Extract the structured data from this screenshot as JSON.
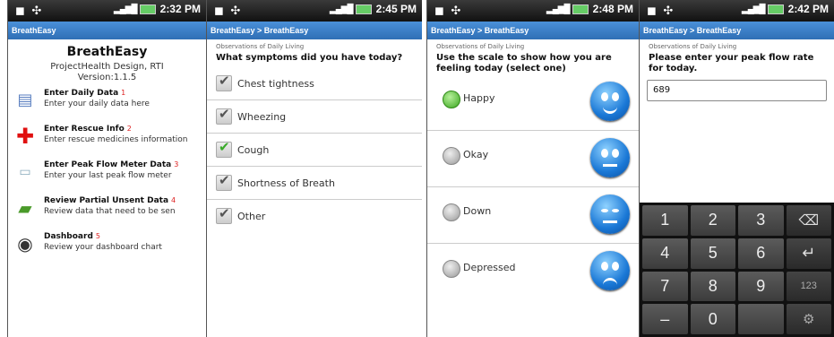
{
  "status": {
    "screen1_time": "2:32 PM",
    "screen2_time": "2:45 PM",
    "screen3_time": "2:48 PM",
    "screen4_time": "2:42 PM"
  },
  "screen1": {
    "title_bar": "BreathEasy",
    "app_title": "BreathEasy",
    "org_line1": "ProjectHealth Design, RTI",
    "org_line2": "Version:1.1.5",
    "menu": [
      {
        "title": "Enter Daily Data",
        "num": "1",
        "desc": "Enter your daily data here",
        "icon": "data-entry-icon"
      },
      {
        "title": "Enter Rescue Info",
        "num": "2",
        "desc": "Enter rescue medicines information",
        "icon": "red-cross-icon"
      },
      {
        "title": "Enter Peak Flow Meter Data",
        "num": "3",
        "desc": "Enter your last peak flow meter",
        "icon": "peak-flow-meter-icon"
      },
      {
        "title": "Review Partial Unsent Data",
        "num": "4",
        "desc": "Review data that need to be sen",
        "icon": "unsent-data-icon"
      },
      {
        "title": "Dashboard",
        "num": "5",
        "desc": "Review your dashboard chart",
        "icon": "dashboard-icon"
      }
    ]
  },
  "screen2": {
    "title_bar": "BreathEasy > BreathEasy",
    "subtitle": "Observations of Daily Living",
    "question": "What symptoms did you have today?",
    "symptoms": [
      "Chest tightness",
      "Wheezing",
      "Cough",
      "Shortness of Breath",
      "Other"
    ]
  },
  "screen3": {
    "title_bar": "BreathEasy > BreathEasy",
    "subtitle": "Observations of Daily Living",
    "question": "Use the scale to show how you are feeling today (select one)",
    "moods": [
      "Happy",
      "Okay",
      "Down",
      "Depressed"
    ],
    "selected": "Happy"
  },
  "screen4": {
    "title_bar": "BreathEasy > BreathEasy",
    "subtitle": "Observations of Daily Living",
    "question": "Please enter your peak flow rate for today.",
    "input_value": "689",
    "keys": [
      "1",
      "2",
      "3",
      "⌫",
      "4",
      "5",
      "6",
      "↵",
      "7",
      "8",
      "9",
      "123",
      "–",
      "0",
      "",
      "⚙"
    ]
  },
  "colors": {
    "titlebar": "#3a80cf",
    "accent_green": "#3aaa2a",
    "number_red": "#dd2222"
  }
}
